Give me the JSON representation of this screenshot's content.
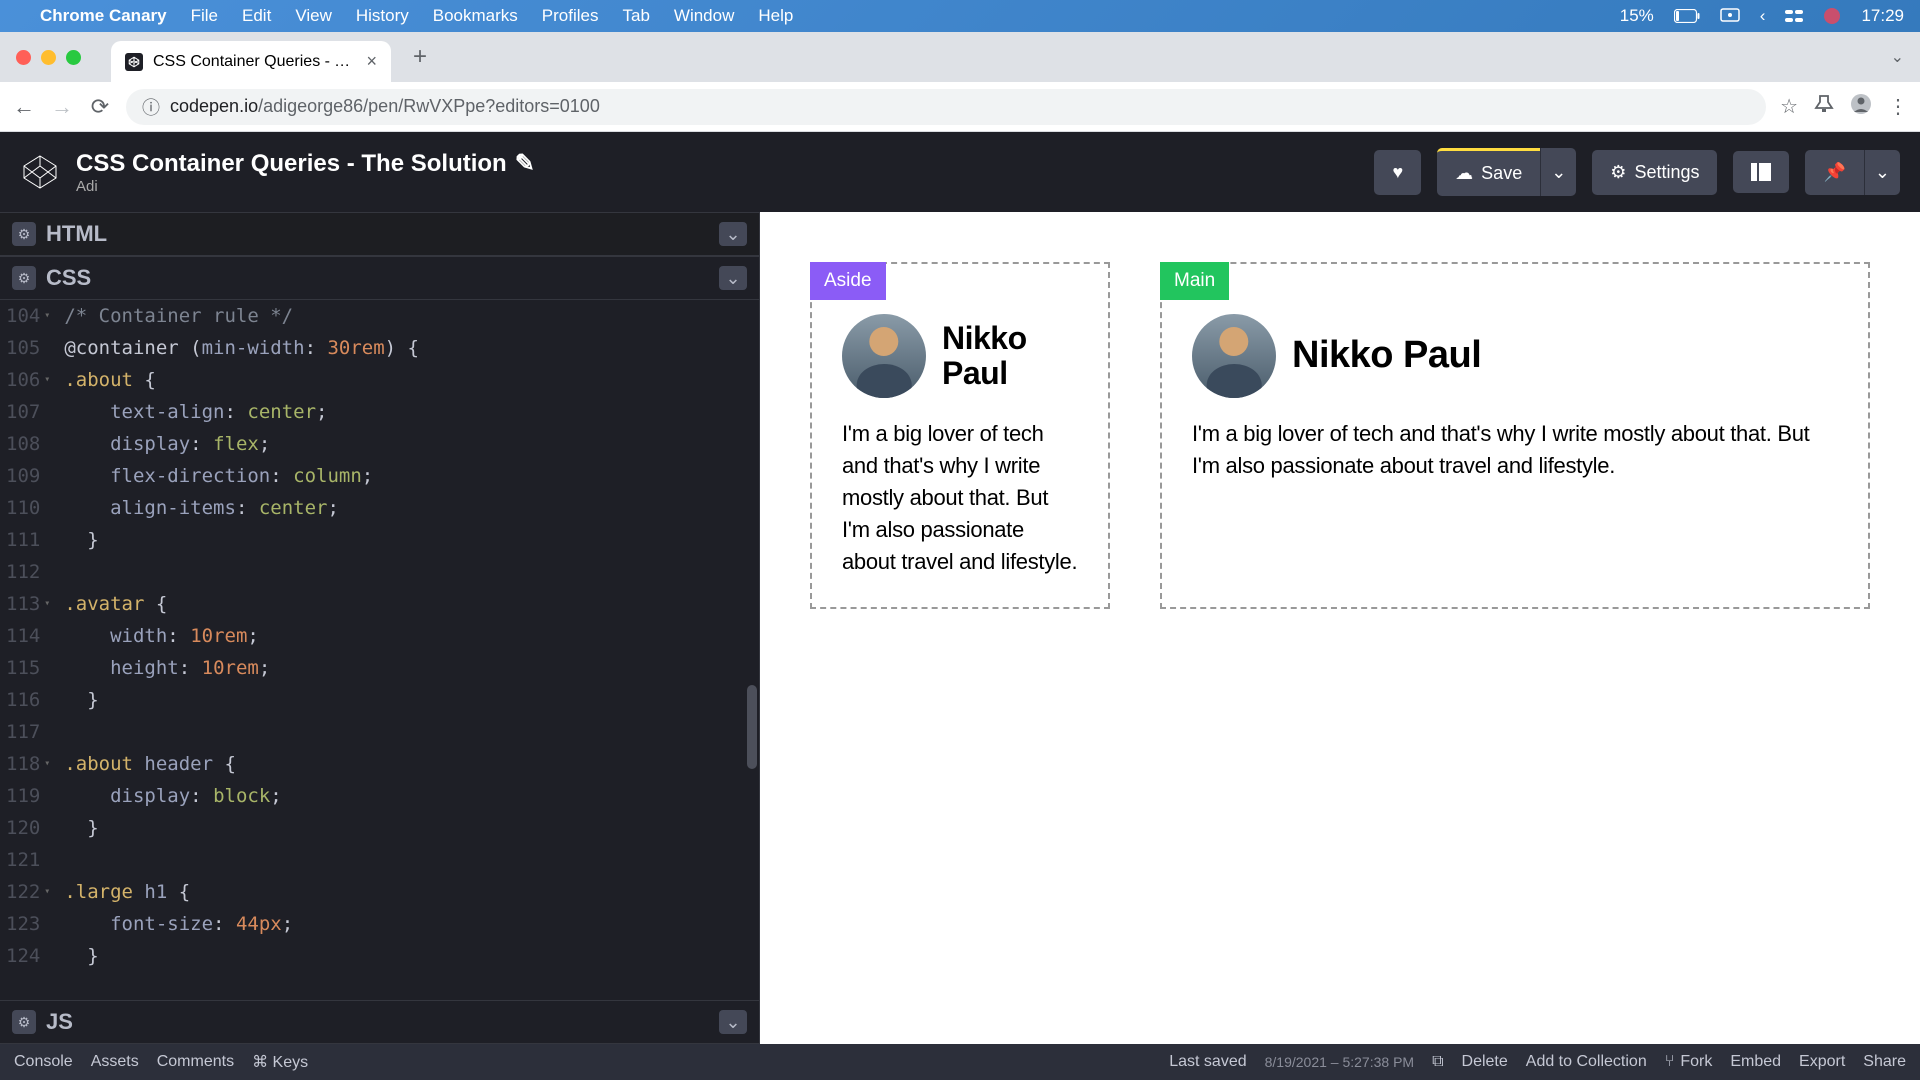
{
  "menubar": {
    "app": "Chrome Canary",
    "items": [
      "File",
      "Edit",
      "View",
      "History",
      "Bookmarks",
      "Profiles",
      "Tab",
      "Window",
      "Help"
    ],
    "battery": "15%",
    "time": "17:29"
  },
  "browser": {
    "tab_title": "CSS Container Queries - The S",
    "url_domain": "codepen.io",
    "url_path": "/adigeorge86/pen/RwVXPpe?editors=0100"
  },
  "codepen": {
    "title": "CSS Container Queries - The Solution",
    "author": "Adi",
    "save_label": "Save",
    "settings_label": "Settings"
  },
  "panels": {
    "html": "HTML",
    "css": "CSS",
    "js": "JS"
  },
  "code": {
    "lines": [
      {
        "n": "104",
        "fold": true,
        "html": "<span class='tok-comment'>/* Container rule */</span>"
      },
      {
        "n": "105",
        "fold": false,
        "html": "<span class='tok-at'>@container</span> (<span class='tok-prop'>min-width</span>: <span class='tok-num'>30rem</span>) <span class='tok-brace'>{</span>"
      },
      {
        "n": "106",
        "fold": true,
        "html": "<span class='tok-selector'>.about</span> <span class='tok-brace'>{</span>"
      },
      {
        "n": "107",
        "fold": false,
        "html": "    <span class='tok-prop'>text-align</span>: <span class='tok-value'>center</span>;"
      },
      {
        "n": "108",
        "fold": false,
        "html": "    <span class='tok-prop'>display</span>: <span class='tok-value'>flex</span>;"
      },
      {
        "n": "109",
        "fold": false,
        "html": "    <span class='tok-prop'>flex-direction</span>: <span class='tok-value'>column</span>;"
      },
      {
        "n": "110",
        "fold": false,
        "html": "    <span class='tok-prop'>align-items</span>: <span class='tok-value'>center</span>;"
      },
      {
        "n": "111",
        "fold": false,
        "html": "  <span class='tok-brace'>}</span>"
      },
      {
        "n": "112",
        "fold": false,
        "html": ""
      },
      {
        "n": "113",
        "fold": true,
        "html": "<span class='tok-selector'>.avatar</span> <span class='tok-brace'>{</span>"
      },
      {
        "n": "114",
        "fold": false,
        "html": "    <span class='tok-prop'>width</span>: <span class='tok-num'>10rem</span>;"
      },
      {
        "n": "115",
        "fold": false,
        "html": "    <span class='tok-prop'>height</span>: <span class='tok-num'>10rem</span>;"
      },
      {
        "n": "116",
        "fold": false,
        "html": "  <span class='tok-brace'>}</span>"
      },
      {
        "n": "117",
        "fold": false,
        "html": ""
      },
      {
        "n": "118",
        "fold": true,
        "html": "<span class='tok-selector'>.about</span> <span class='tok-tag'>header</span> <span class='tok-brace'>{</span>"
      },
      {
        "n": "119",
        "fold": false,
        "html": "    <span class='tok-prop'>display</span>: <span class='tok-value'>block</span>;"
      },
      {
        "n": "120",
        "fold": false,
        "html": "  <span class='tok-brace'>}</span>"
      },
      {
        "n": "121",
        "fold": false,
        "html": ""
      },
      {
        "n": "122",
        "fold": true,
        "html": "<span class='tok-selector'>.large</span> <span class='tok-tag'>h1</span> <span class='tok-brace'>{</span>"
      },
      {
        "n": "123",
        "fold": false,
        "html": "    <span class='tok-prop'>font-size</span>: <span class='tok-num'>44px</span>;"
      },
      {
        "n": "124",
        "fold": false,
        "html": "  <span class='tok-brace'>}</span>"
      }
    ]
  },
  "preview": {
    "aside_label": "Aside",
    "main_label": "Main",
    "name": "Nikko Paul",
    "bio": "I'm a big lover of tech and that's why I write mostly about that. But I'm also passionate about travel and lifestyle."
  },
  "footer": {
    "console": "Console",
    "assets": "Assets",
    "comments": "Comments",
    "keys": "⌘ Keys",
    "saved_label": "Last saved",
    "saved_time": "8/19/2021 – 5:27:38 PM",
    "delete": "Delete",
    "add": "Add to Collection",
    "fork": "Fork",
    "embed": "Embed",
    "export": "Export",
    "share": "Share"
  }
}
